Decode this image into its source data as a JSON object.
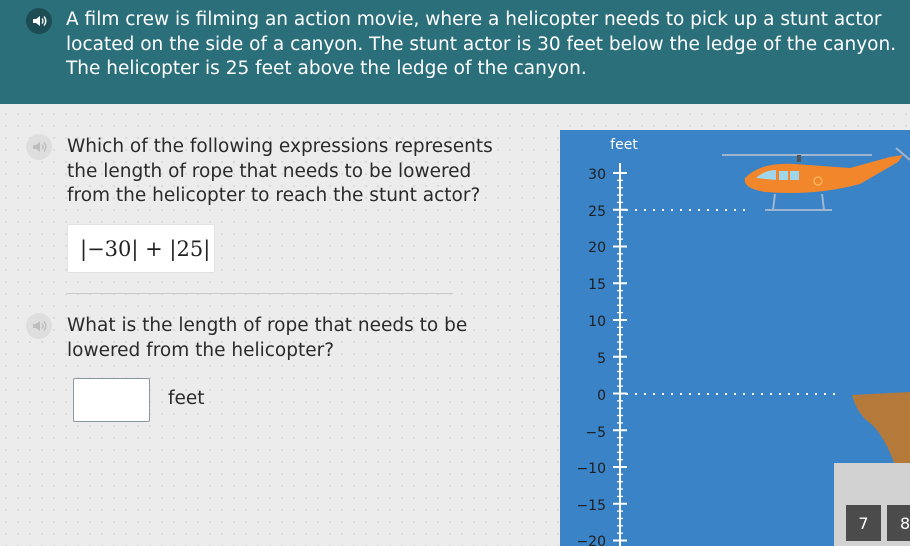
{
  "problem": {
    "text": "A film crew is filming an action movie, where a helicopter needs to pick up a stunt actor located on the side of a canyon. The stunt actor is 30 feet below the ledge of the canyon. The helicopter is 25 feet above the ledge of the canyon."
  },
  "question1": {
    "text": "Which of the following expressions represents the length of rope that needs to be lowered from the helicopter to reach the stunt actor?",
    "answer": "|−30| + |25|"
  },
  "question2": {
    "text": "What is the length of rope that needs to be lowered from the helicopter?",
    "input_value": "",
    "unit": "feet"
  },
  "graph": {
    "axis_label": "feet",
    "ticks": [
      "30",
      "25",
      "20",
      "15",
      "10",
      "5",
      "0",
      "−5",
      "−10",
      "−15",
      "−20"
    ],
    "colors": {
      "sky": "#3a83c7",
      "helicopter": "#f2862a",
      "canyon": "#b57a3a"
    }
  },
  "keypad": {
    "keys": [
      "7",
      "8"
    ]
  },
  "icons": {
    "audio": "speaker-icon",
    "vehicle": "helicopter-icon"
  }
}
